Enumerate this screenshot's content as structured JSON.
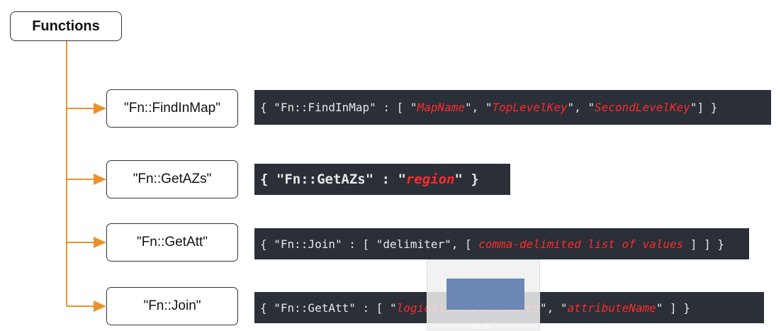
{
  "root": {
    "label": "Functions"
  },
  "functions": [
    {
      "label": "\"Fn::FindInMap\"",
      "code": [
        {
          "t": "{ \"Fn::FindInMap\" : [ \"",
          "h": false
        },
        {
          "t": "MapName",
          "h": true
        },
        {
          "t": "\", \"",
          "h": false
        },
        {
          "t": "TopLevelKey",
          "h": true
        },
        {
          "t": "\", \"",
          "h": false
        },
        {
          "t": "SecondLevelKey",
          "h": true
        },
        {
          "t": "\"] }",
          "h": false
        }
      ]
    },
    {
      "label": "\"Fn::GetAZs\"",
      "code": [
        {
          "t": "{ \"Fn::GetAZs\" : \"",
          "h": false
        },
        {
          "t": "region",
          "h": true
        },
        {
          "t": "\" }",
          "h": false
        }
      ]
    },
    {
      "label": "\"Fn::GetAtt\"",
      "code": [
        {
          "t": "{ \"Fn::Join\" : [ \"delimiter\", [ ",
          "h": false
        },
        {
          "t": "comma-delimited list of values",
          "h": true
        },
        {
          "t": " ] ] }",
          "h": false
        }
      ]
    },
    {
      "label": "\"Fn::Join\"",
      "code": [
        {
          "t": "{ \"Fn::GetAtt\" : [ \"",
          "h": false
        },
        {
          "t": "logicalNameOfResource",
          "h": true
        },
        {
          "t": "\", \"",
          "h": false
        },
        {
          "t": "attributeName",
          "h": true
        },
        {
          "t": "\" ] }",
          "h": false
        }
      ]
    }
  ],
  "overlay": {
    "timestamp": "04:16"
  },
  "colors": {
    "connector": "#e8932c",
    "code_bg": "#2a2f38",
    "highlight": "#ff2a2a"
  }
}
